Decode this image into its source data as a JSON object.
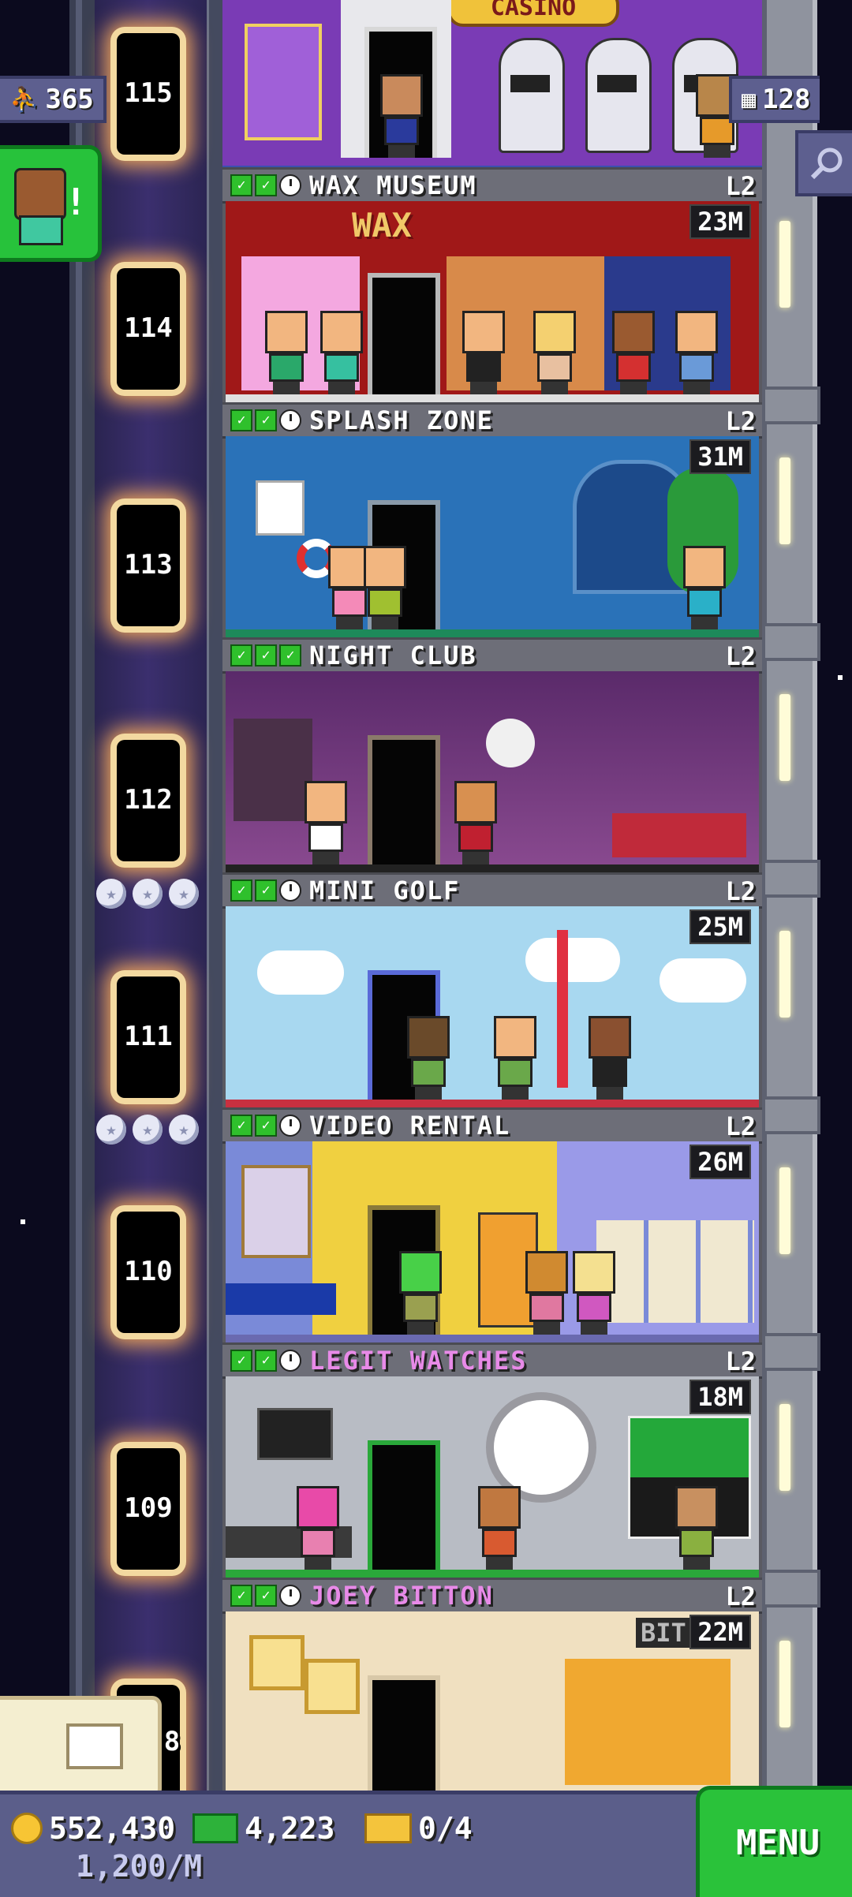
{
  "hud": {
    "population": "365",
    "floors_count": "128"
  },
  "elevator_floors": [
    "115",
    "114",
    "113",
    "112",
    "111",
    "110",
    "109",
    "8"
  ],
  "top_partial_floor": {
    "sign": "CASINO"
  },
  "floors": [
    {
      "name": "WAX MUSEUM",
      "level": "L2",
      "stock": "23M",
      "checks": 2,
      "clock": true,
      "name_color": "white"
    },
    {
      "name": "SPLASH ZONE",
      "level": "L2",
      "stock": "31M",
      "checks": 2,
      "clock": true,
      "name_color": "white"
    },
    {
      "name": "NIGHT CLUB",
      "level": "L2",
      "stock": "",
      "checks": 3,
      "clock": false,
      "name_color": "white"
    },
    {
      "name": "MINI GOLF",
      "level": "L2",
      "stock": "25M",
      "checks": 2,
      "clock": true,
      "name_color": "white"
    },
    {
      "name": "VIDEO RENTAL",
      "level": "L2",
      "stock": "26M",
      "checks": 2,
      "clock": true,
      "name_color": "white"
    },
    {
      "name": "LEGIT WATCHES",
      "level": "L2",
      "stock": "18M",
      "checks": 2,
      "clock": true,
      "name_color": "purple"
    },
    {
      "name": "JOEY BITTON",
      "level": "L2",
      "stock": "22M",
      "checks": 2,
      "clock": true,
      "name_color": "purple"
    }
  ],
  "floor_signs": {
    "wax": "WAX",
    "bit": "BIT"
  },
  "bottom_bar": {
    "coins": "552,430",
    "coins_rate": "1,200/M",
    "bux": "4,223",
    "tickets": "0/4",
    "menu_label": "MENU"
  }
}
